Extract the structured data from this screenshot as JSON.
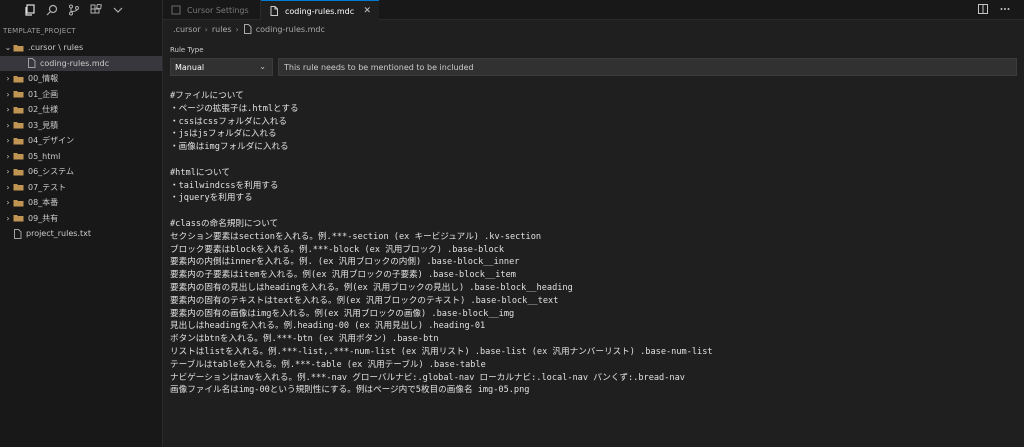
{
  "sidebar": {
    "section_title": "TEMPLATE_PROJECT",
    "toolbar_icons": [
      "explorer-icon",
      "search-icon",
      "source-control-icon",
      "extensions-icon",
      "more-icon"
    ],
    "items": [
      {
        "label": ".cursor \\ rules",
        "type": "folder-open",
        "indent": 0
      },
      {
        "label": "coding-rules.mdc",
        "type": "file",
        "indent": 1,
        "selected": true
      },
      {
        "label": "00_情報",
        "type": "folder",
        "indent": 0
      },
      {
        "label": "01_企画",
        "type": "folder",
        "indent": 0
      },
      {
        "label": "02_仕様",
        "type": "folder",
        "indent": 0
      },
      {
        "label": "03_見積",
        "type": "folder",
        "indent": 0
      },
      {
        "label": "04_デザイン",
        "type": "folder",
        "indent": 0
      },
      {
        "label": "05_html",
        "type": "folder",
        "indent": 0
      },
      {
        "label": "06_システム",
        "type": "folder",
        "indent": 0
      },
      {
        "label": "07_テスト",
        "type": "folder",
        "indent": 0
      },
      {
        "label": "08_本番",
        "type": "folder",
        "indent": 0
      },
      {
        "label": "09_共有",
        "type": "folder",
        "indent": 0
      },
      {
        "label": "project_rules.txt",
        "type": "file",
        "indent": 0
      }
    ]
  },
  "tabs": {
    "inactive_label": "Cursor Settings",
    "active_label": "coding-rules.mdc",
    "close_symbol": "✕"
  },
  "breadcrumb": {
    "part1": ".cursor",
    "part2": "rules",
    "part3": "coding-rules.mdc"
  },
  "rule": {
    "label": "Rule Type",
    "selected": "Manual",
    "description": "This rule needs to be mentioned to be included"
  },
  "editor_lines": [
    "#ファイルについて",
    "・ページの拡張子は.htmlとする",
    "・cssはcssフォルダに入れる",
    "・jsはjsフォルダに入れる",
    "・画像はimgフォルダに入れる",
    "",
    "#htmlについて",
    "・tailwindcssを利用する",
    "・jqueryを利用する",
    "",
    "#classの命名規則について",
    "セクション要素はsectionを入れる。例.***-section (ex キービジュアル) .kv-section",
    "ブロック要素はblockを入れる。例.***-block (ex 汎用ブロック) .base-block",
    "要素内の内側はinnerを入れる。例. (ex 汎用ブロックの内側) .base-block__inner",
    "要素内の子要素はitemを入れる。例(ex 汎用ブロックの子要素) .base-block__item",
    "要素内の固有の見出しはheadingを入れる。例(ex 汎用ブロックの見出し) .base-block__heading",
    "要素内の固有のテキストはtextを入れる。例(ex 汎用ブロックのテキスト) .base-block__text",
    "要素内の固有の画像はimgを入れる。例(ex 汎用ブロックの画像) .base-block__img",
    "見出しはheadingを入れる。例.heading-00 (ex 汎用見出し) .heading-01",
    "ボタンはbtnを入れる。例.***-btn (ex 汎用ボタン) .base-btn",
    "リストはlistを入れる。例.***-list,.***-num-list (ex 汎用リスト) .base-list (ex 汎用ナンバーリスト) .base-num-list",
    "テーブルはtableを入れる。例.***-table (ex 汎用テーブル) .base-table",
    "ナビゲーションはnavを入れる。例.***-nav グローバルナビ:.global-nav ローカルナビ:.local-nav パンくず:.bread-nav",
    "画像ファイル名はimg-00という規則性にする。例はページ内で5枚目の画像名 img-05.png"
  ]
}
